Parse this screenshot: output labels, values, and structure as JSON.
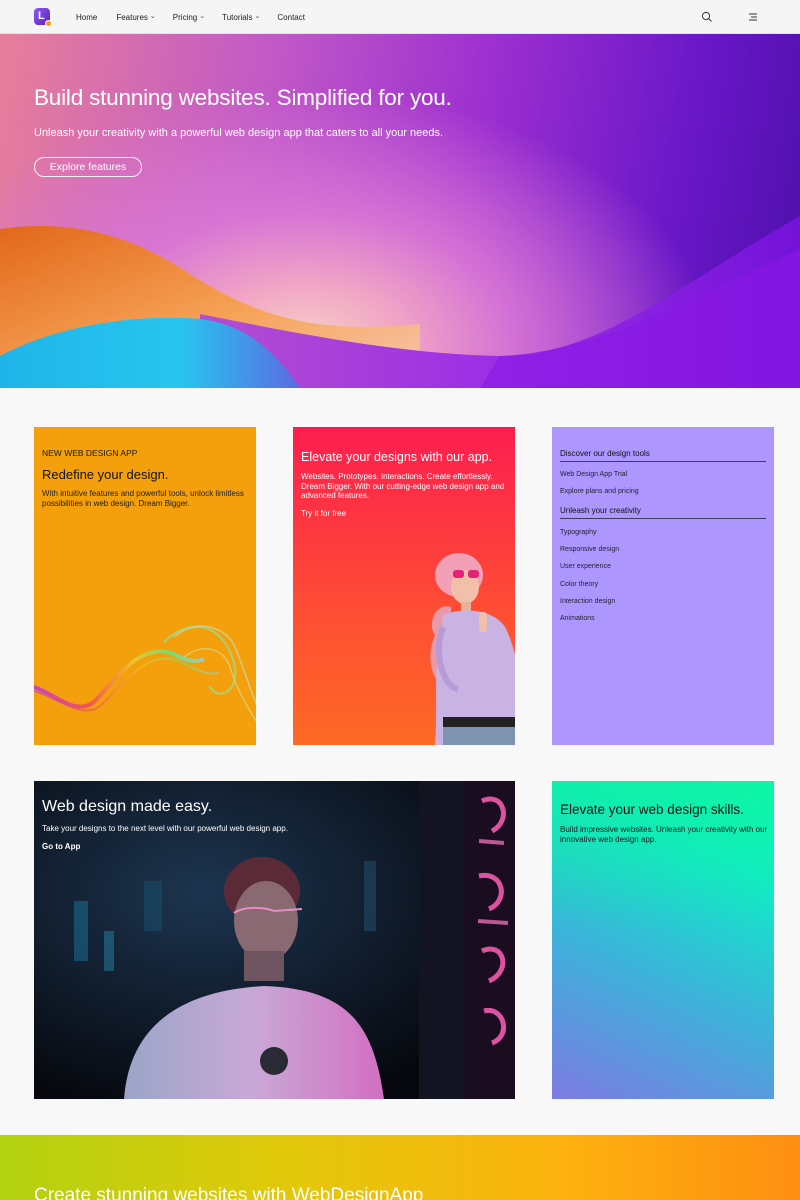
{
  "nav": {
    "logo_letter": "L",
    "items": [
      {
        "label": "Home",
        "dropdown": false
      },
      {
        "label": "Features",
        "dropdown": true
      },
      {
        "label": "Pricing",
        "dropdown": true
      },
      {
        "label": "Tutorials",
        "dropdown": true
      },
      {
        "label": "Contact",
        "dropdown": false
      }
    ],
    "search_icon": "search-icon",
    "menu_icon": "menu-lines-icon"
  },
  "hero": {
    "title": "Build stunning websites. Simplified for you.",
    "subtitle": "Unleash your creativity with a powerful web design app that caters to all your needs.",
    "button": "Explore features"
  },
  "card1": {
    "eyebrow": "NEW WEB DESIGN APP",
    "title": "Redefine your design.",
    "description": "With intuitive features and powerful tools, unlock limitless possibilities in web design. Dream Bigger.",
    "background": "#f4a00c"
  },
  "card2": {
    "title": "Elevate your designs with our app.",
    "description": "Websites. Prototypes. Interactions. Create effortlessly. Dream Bigger. With our cutting-edge web design app and advanced features.",
    "link": "Try it for free"
  },
  "card3": {
    "section1": "Discover our design tools",
    "links1": [
      "Web Design App Trial",
      "Explore plans and pricing"
    ],
    "section2": "Unleash your creativity",
    "links2": [
      "Typography",
      "Responsive design",
      "User experience",
      "Color theory",
      "Interaction design",
      "Animations"
    ],
    "background": "#ad97ff"
  },
  "card4": {
    "title": "Web design made easy.",
    "description": "Take your designs to the next level with our powerful web design app.",
    "link": "Go to App"
  },
  "card5": {
    "title": "Elevate your web design skills.",
    "description": "Build impressive websites. Unleash your creativity with our innovative web design app."
  },
  "banner": {
    "title": "Create stunning websites with WebDesignApp"
  }
}
